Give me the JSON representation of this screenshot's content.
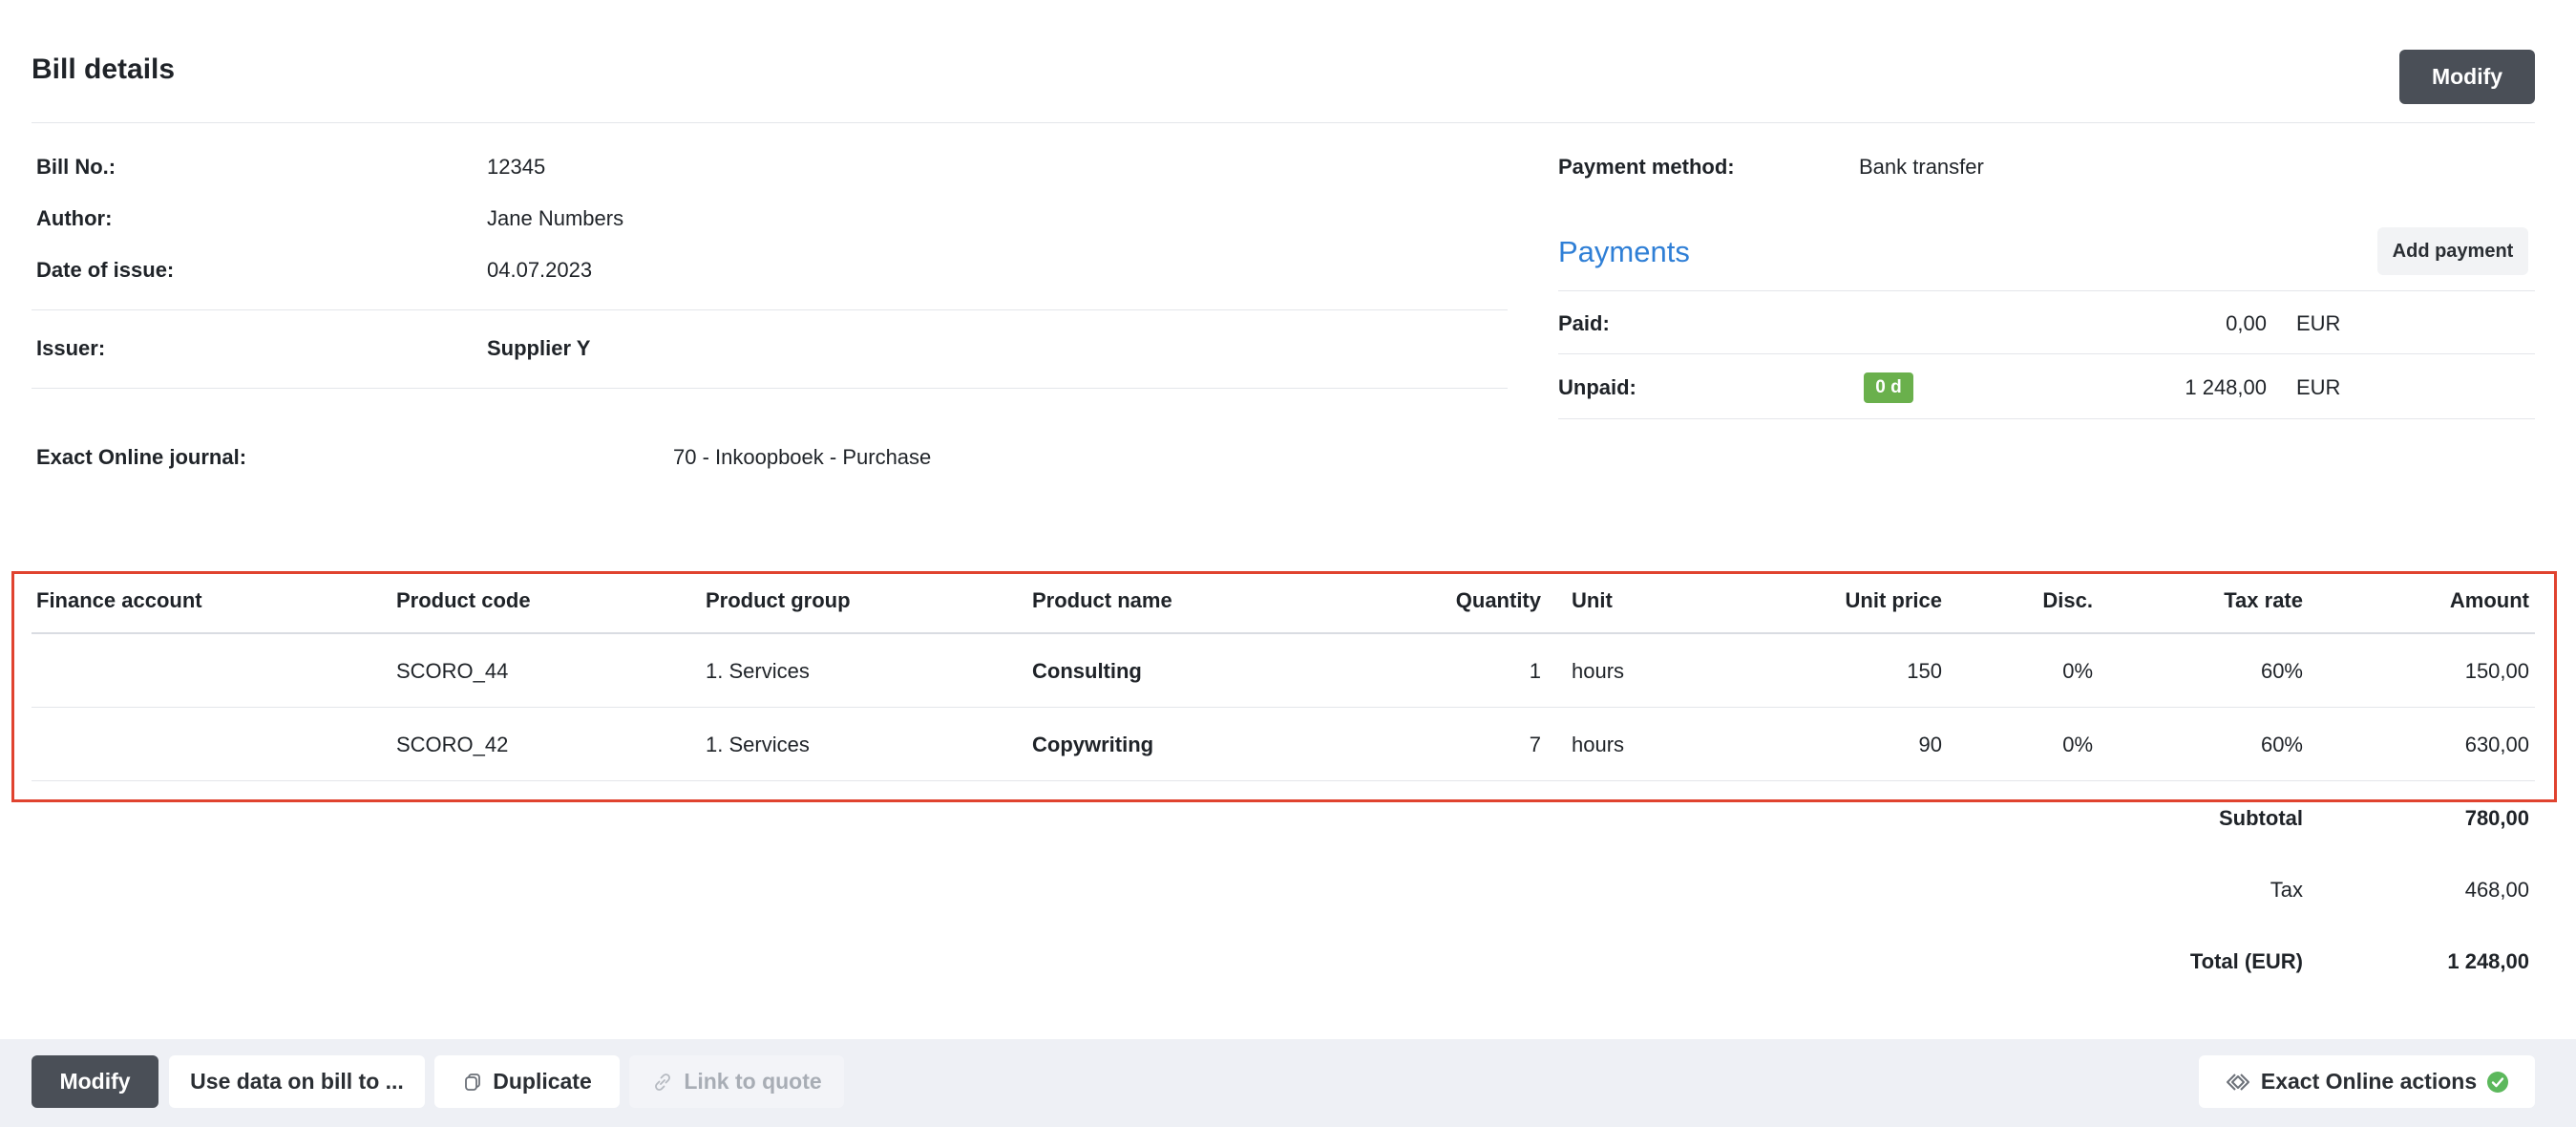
{
  "header": {
    "title": "Bill details",
    "modify_label": "Modify"
  },
  "details": {
    "bill_no_label": "Bill No.:",
    "bill_no_value": "12345",
    "author_label": "Author:",
    "author_value": "Jane Numbers",
    "date_label": "Date of issue:",
    "date_value": "04.07.2023",
    "issuer_label": "Issuer:",
    "issuer_value": "Supplier Y",
    "journal_label": "Exact Online journal:",
    "journal_value": "70 - Inkoopboek - Purchase"
  },
  "payment": {
    "method_label": "Payment method:",
    "method_value": "Bank transfer",
    "payments_title": "Payments",
    "add_payment_label": "Add payment",
    "paid_label": "Paid:",
    "paid_amount": "0,00",
    "paid_currency": "EUR",
    "unpaid_label": "Unpaid:",
    "unpaid_badge": "0 d",
    "unpaid_amount": "1 248,00",
    "unpaid_currency": "EUR",
    "badge_color": "#6ab04c",
    "link_color": "#2f7fd6"
  },
  "table": {
    "columns": [
      "Finance account",
      "Product code",
      "Product group",
      "Product name",
      "Quantity",
      "Unit",
      "Unit price",
      "Disc.",
      "Tax rate",
      "Amount"
    ],
    "rows": [
      {
        "finance_account": "",
        "product_code": "SCORO_44",
        "product_group": "1. Services",
        "product_name": "Consulting",
        "quantity": "1",
        "unit": "hours",
        "unit_price": "150",
        "disc": "0%",
        "tax_rate": "60%",
        "amount": "150,00"
      },
      {
        "finance_account": "",
        "product_code": "SCORO_42",
        "product_group": "1. Services",
        "product_name": "Copywriting",
        "quantity": "7",
        "unit": "hours",
        "unit_price": "90",
        "disc": "0%",
        "tax_rate": "60%",
        "amount": "630,00"
      }
    ]
  },
  "totals": {
    "subtotal_label": "Subtotal",
    "subtotal_value": "780,00",
    "tax_label": "Tax",
    "tax_value": "468,00",
    "total_label": "Total (EUR)",
    "total_value": "1 248,00"
  },
  "footer": {
    "modify_label": "Modify",
    "use_data_label": "Use data on bill to ...",
    "duplicate_label": "Duplicate",
    "link_quote_label": "Link to quote",
    "exact_actions_label": "Exact Online actions",
    "icons": {
      "duplicate": "duplicate-icon",
      "link": "link-icon",
      "exact": "exact-online-icon",
      "status": "check-circle-icon"
    }
  }
}
